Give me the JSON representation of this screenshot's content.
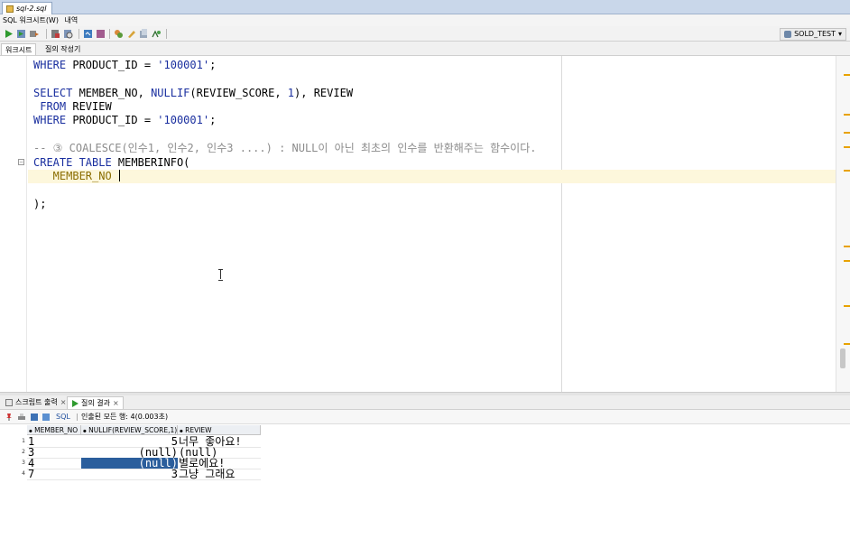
{
  "window": {
    "tab_title": "sql-2.sql"
  },
  "menu": {
    "items": [
      "SQL 워크시트(W)",
      "내역"
    ]
  },
  "toolbar": {
    "connection": "SOLD_TEST",
    "buttons": [
      "run-statement-icon",
      "run-script-icon",
      "commit-icon",
      "rollback-icon",
      "explain-plan-icon",
      "autotrace-icon",
      "sql-tuning-icon",
      "clear-icon",
      "format-icon",
      "history-icon",
      "find-icon"
    ]
  },
  "worksheet_tabs": {
    "worksheet": "워크시트",
    "query_builder": "질의 작성기"
  },
  "editor": {
    "lines": [
      {
        "t1": "WHERE ",
        "t2": "PRODUCT_ID = ",
        "t3": "'100001'",
        "t4": ";"
      },
      {
        "t1": "SELECT ",
        "t2": "MEMBER_NO, ",
        "t3": "NULLIF",
        "t4": "(REVIEW_SCORE, ",
        "t5": "1",
        "t6": "), REVIEW"
      },
      {
        "t1": " FROM ",
        "t2": "REVIEW"
      },
      {
        "t1": "WHERE ",
        "t2": "PRODUCT_ID = ",
        "t3": "'100001'",
        "t4": ";"
      },
      {
        "t1": "-- ③ COALESCE(인수1, 인수2, 인수3 ....) : NULL이 아닌 최초의 인수를 반환해주는 함수이다."
      },
      {
        "t1": "CREATE TABLE ",
        "t2": "MEMBERINFO("
      },
      {
        "t1": "   MEMBER_NO "
      },
      {
        "t1": ");"
      }
    ]
  },
  "bottom_tabs": {
    "script_output": "스크립트 출력",
    "query_result": "질의 결과",
    "close": "×"
  },
  "results": {
    "sql_label": "SQL",
    "status": "인출된 모든 행: 4(0.003초)",
    "columns": [
      "MEMBER_NO",
      "NULLIF(REVIEW_SCORE,1)",
      "REVIEW"
    ],
    "rows": [
      {
        "n": "1",
        "member_no": "1",
        "score": "5",
        "review": "너무 좋아요!"
      },
      {
        "n": "2",
        "member_no": "3",
        "score": "(null)",
        "review": "(null)"
      },
      {
        "n": "3",
        "member_no": "4",
        "score": "(null)",
        "review": "별로에요!"
      },
      {
        "n": "4",
        "member_no": "7",
        "score": "3",
        "review": "그냥 그래요"
      }
    ]
  }
}
